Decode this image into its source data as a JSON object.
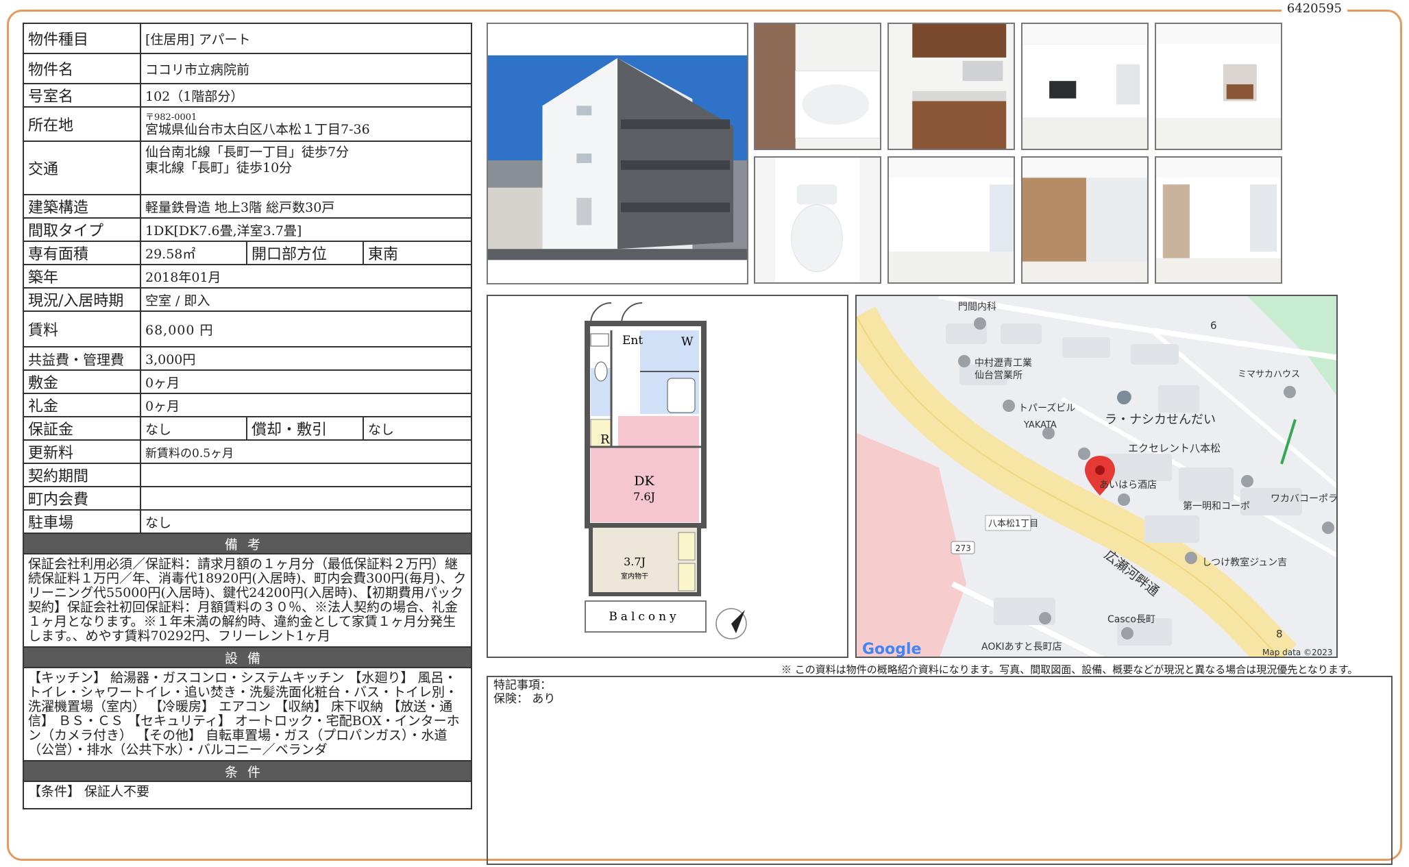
{
  "doc_id": "6420595",
  "property": {
    "type_label": "物件種目",
    "type_value": "[住居用] アパート",
    "name_label": "物件名",
    "name_value": "ココリ市立病院前",
    "room_label": "号室名",
    "room_value": "102（1階部分）",
    "address_label": "所在地",
    "postal": "〒982-0001",
    "address_value": "宮城県仙台市太白区八本松１丁目7-36",
    "access_label": "交通",
    "access_line1": "仙台南北線「長町一丁目」徒歩7分",
    "access_line2": "東北線「長町」徒歩10分",
    "structure_label": "建築構造",
    "structure_value": "軽量鉄骨造 地上3階 総戸数30戸",
    "layout_label": "間取タイプ",
    "layout_value": "1DK[DK7.6畳,洋室3.7畳]",
    "area_label": "専有面積",
    "area_value": "29.58㎡",
    "direction_label": "開口部方位",
    "direction_value": "東南",
    "built_label": "築年",
    "built_value": "2018年01月",
    "status_label": "現況/入居時期",
    "status_value": "空室 / 即入",
    "rent_label": "賃料",
    "rent_value": "68,000 円",
    "fee_label": "共益費・管理費",
    "fee_value": "3,000円",
    "deposit_label": "敷金",
    "deposit_value": "0ヶ月",
    "keymoney_label": "礼金",
    "keymoney_value": "0ヶ月",
    "guarantee_label": "保証金",
    "guarantee_value": "なし",
    "amort_label": "償却・敷引",
    "amort_value": "なし",
    "renewal_label": "更新料",
    "renewal_value": "新賃料の0.5ヶ月",
    "contract_label": "契約期間",
    "contract_value": "",
    "community_label": "町内会費",
    "community_value": "",
    "parking_label": "駐車場",
    "parking_value": "なし"
  },
  "remarks_head": "備考",
  "remarks_text": "保証会社利用必須／保証料：請求月額の１ヶ月分（最低保証料２万円）継続保証料１万円／年、消毒代18920円(入居時)、町内会費300円(毎月)、クリーニング代55000円(入居時)、鍵代24200円(入居時)、【初期費用パック契約】保証会社初回保証料：月額賃料の３０％、※法人契約の場合、礼金１ヶ月となります。※１年未満の解約時、違約金として家賃１ヶ月分発生します。、めやす賃料70292円、フリーレント1ヶ月",
  "facilities_head": "設備",
  "facilities_text": "【キッチン】 給湯器・ガスコンロ・システムキッチン 【水廻り】 風呂・トイレ・シャワートイレ・追い焚き・洗髪洗面化粧台・バス・トイレ別・洗濯機置場（室内） 【冷暖房】 エアコン 【収納】 床下収納 【放送・通信】 ＢＳ・ＣＳ 【セキュリティ】 オートロック・宅配BOX・インターホン（カメラ付き） 【その他】 自転車置場・ガス（プロパンガス）・水道（公営）・排水（公共下水）・バルコニー／ベランダ",
  "conditions_head": "条件",
  "conditions_text": "【条件】 保証人不要",
  "floorplan": {
    "ent": "Ent",
    "w": "W",
    "r": "R",
    "dk": "DK",
    "dk_size": "7.6J",
    "room_size": "3.7J",
    "room_note": "室内物干",
    "balcony": "Balcony"
  },
  "map": {
    "places": [
      "門間内科",
      "中村瀝青工業",
      "仙台営業所",
      "ミマサカハウス",
      "トパーズビル",
      "YAKATA",
      "ラ・ナシカせんだい",
      "エクセレント八本松",
      "あいはら酒店",
      "第一明和コーポ",
      "ワカバコーポラ",
      "八本松1丁目",
      "しつけ教室ジュン吉",
      "広瀬河畔通",
      "Casco長町",
      "AOKIあすと長町店",
      "6",
      "8",
      "273"
    ],
    "logo": "Google",
    "attribution": "Map data ©2023"
  },
  "disclaimer": "※ この資料は物件の概略紹介資料になります。写真、間取図面、設備、概要などが現況と異なる場合は現況優先となります。",
  "special_label": "特記事項：",
  "insurance": "保険： あり"
}
